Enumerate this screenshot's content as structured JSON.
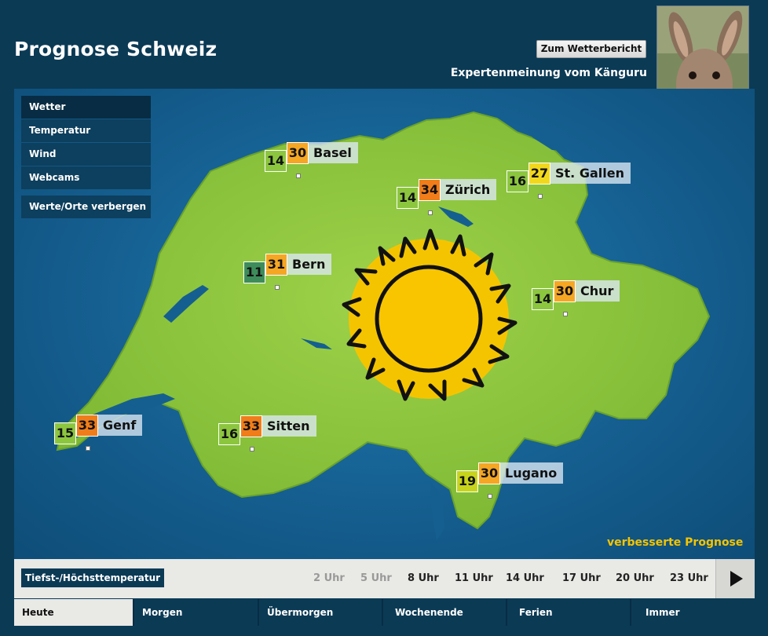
{
  "header": {
    "title": "Prognose Schweiz",
    "report_button": "Zum Wetterbericht",
    "expert_text": "Expertenmeinung vom Känguru"
  },
  "menu": {
    "items": [
      "Wetter",
      "Temperatur",
      "Wind",
      "Webcams"
    ],
    "toggle": "Werte/Orte verbergen"
  },
  "cities": [
    {
      "name": "Basel",
      "low": "14",
      "high": "30"
    },
    {
      "name": "Zürich",
      "low": "14",
      "high": "34"
    },
    {
      "name": "St. Gallen",
      "low": "16",
      "high": "27"
    },
    {
      "name": "Bern",
      "low": "11",
      "high": "31"
    },
    {
      "name": "Chur",
      "low": "14",
      "high": "30"
    },
    {
      "name": "Genf",
      "low": "15",
      "high": "33"
    },
    {
      "name": "Sitten",
      "low": "16",
      "high": "33"
    },
    {
      "name": "Lugano",
      "low": "19",
      "high": "30"
    }
  ],
  "improved_forecast": "verbesserte Prognose",
  "timebar": {
    "legend": "Tiefst-/Höchsttemperatur",
    "times": [
      "2 Uhr",
      "5 Uhr",
      "8 Uhr",
      "11 Uhr",
      "14 Uhr",
      "17 Uhr",
      "20 Uhr",
      "23 Uhr"
    ]
  },
  "tabs": [
    "Heute",
    "Morgen",
    "Übermorgen",
    "Wochenende",
    "Ferien",
    "Immer"
  ],
  "colors": {
    "background": "#0b3a55",
    "land": "#8cc63f",
    "lake": "#155f90",
    "sun": "#f5c400",
    "temp_orange": "#f07d1a",
    "temp_amber": "#f5a623",
    "temp_yellow": "#f2d81c",
    "temp_green": "#8cc63f",
    "temp_darkgreen": "#3e8c5a"
  },
  "icons": {
    "weather": "sun-icon",
    "play": "play-icon"
  }
}
